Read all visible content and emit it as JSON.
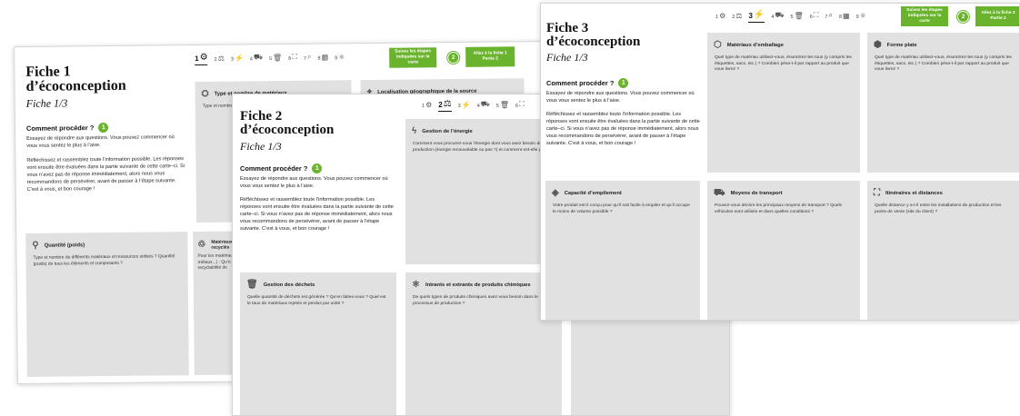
{
  "step_icons": [
    "⚙",
    "⚖",
    "⚡",
    "⛟",
    "🗑",
    "⛶",
    "⌕",
    "▦",
    "⚛"
  ],
  "sheet1": {
    "title_line1": "Fiche 1",
    "title_line2": "d’écoconception",
    "subtitle": "Fiche 1/3",
    "howto": "Comment procéder ?",
    "howto_num": "1",
    "para1": "Essayez de répondre aux questions. Vous pouvez commencer où vous vous sentez le plus à l’aise.",
    "para2": "Réfléchissez et rassemblez toute l’information possible. Les réponses vont ensuite être évaluées dans la partie suivante de cette carte–ci. Si vous n’avez pas de réponse immédiatement, alors nous vous recommandons de persévérer, avant de passer à l’étape suivante. C’est à vous, et bon courage !",
    "steps": [
      "1",
      "2",
      "3",
      "4",
      "5",
      "6",
      "7",
      "8",
      "9"
    ],
    "green_left": "Suivez les étapes indiquées sur la carte",
    "green_num": "2",
    "green_right": "Allez à la fiche 1 Partie 2",
    "cards": [
      {
        "title": "Type et nombre de matériaux",
        "icon": "⛭",
        "q": "Type et nombre"
      },
      {
        "title": "Localisation géographique de la source",
        "icon": "⌖",
        "q": ""
      },
      {
        "title": "Quantité (poids)",
        "icon": "⚲",
        "q": "Type et nombre de différents matériaux et ressources utilisés ? Quantité (poids) de tous les éléments et composants ?"
      },
      {
        "title": "Matériaux recyclés",
        "icon": "♲",
        "q": "Pour les matériaux métaux...) : Qu’e recyclabilité de"
      }
    ]
  },
  "sheet2": {
    "title_line1": "Fiche 2",
    "title_line2": "d’écoconception",
    "subtitle": "Fiche 1/3",
    "howto": "Comment procéder ?",
    "howto_num": "1",
    "para1": "Essayez de répondre aux questions. Vous pouvez commencer où vous vous sentez le plus à l’aise.",
    "para2": "Réfléchissez et rassemblez toute l’information possible. Les réponses vont ensuite être évaluées dans la partie suivante de cette carte–ci. Si vous n’avez pas de réponse immédiatement, alors nous vous recommandons de persévérer, avant de passer à l’étape suivante. C’est à vous, et bon courage !",
    "steps": [
      "1",
      "2",
      "3",
      "4",
      "5",
      "6"
    ],
    "cards": [
      {
        "title": "Gestion de l’énergie",
        "icon": "ϟ",
        "q": "Comment vous procurez-vous l’énergie dont vous avez besoin dans la production (énergie renouvelable ou pas ?) et comment est-elle gérée ?"
      },
      {
        "title": "Gestion des déchets",
        "icon": "🗑",
        "q": "Quelle quantité de déchets est générée ? Qu’en faites-vous ? Quel est le taux de matériaux rejetés et perdus par unité ?"
      },
      {
        "title": "Intrants et extrants de produits chimiques",
        "icon": "⚛",
        "q": "De quels types de produits chimiques avez-vous besoin dans le processus de production ?"
      }
    ]
  },
  "sheet3": {
    "title_line1": "Fiche 3",
    "title_line2": "d’écoconception",
    "subtitle": "Fiche 1/3",
    "howto": "Comment procéder ?",
    "howto_num": "1",
    "para1": "Essayez de répondre aux questions. Vous pouvez commencer où vous vous sentez le plus à l’aise.",
    "para2": "Réfléchissez et rassemblez toute l’information possible. Les réponses vont ensuite être évaluées dans la partie suivante de cette carte–ci. Si vous n’avez pas de réponse immédiatement, alors nous vous recommandons de persévérer, avant de passer à l’étape suivante. C’est à vous, et bon courage !",
    "steps": [
      "1",
      "2",
      "3",
      "4",
      "5",
      "6",
      "7",
      "8",
      "9"
    ],
    "green_left": "Suivez les étapes indiquées sur la carte",
    "green_num": "2",
    "green_right": "Allez à la fiche 3 Partie 2",
    "cards": [
      {
        "title": "Matériaux d’emballage",
        "icon": "⬡",
        "q": "Quel type de matériau utilisez-vous, énumérez-les tous (y compris les étiquettes, sacs, etc.) ? Combien pèse-t-il par rapport au produit que vous livrez ?"
      },
      {
        "title": "Forme plate",
        "icon": "⬢",
        "q": "Quel type de matériau utilisez-vous, énumérez-les tous (y compris les étiquettes, sacs, etc.) ? Combien pèse-t-il par rapport au produit que vous livrez ?"
      },
      {
        "title": "Capacité d’empilement",
        "icon": "◈",
        "q": "Votre produit est-il conçu pour qu’il soit facile à empiler et qu’il occupe le moins de volume possible ?"
      },
      {
        "title": "Moyens de transport",
        "icon": "⛟",
        "q": "Pouvez-vous décrire les principaux moyens de transport ? Quels véhicules sont utilisés et dans quelles conditions ?"
      },
      {
        "title": "Itinéraires et distances",
        "icon": "⛶",
        "q": "Quelle distance y a-t-il entre les installations de production et les points de vente (site du client) ?"
      }
    ]
  }
}
